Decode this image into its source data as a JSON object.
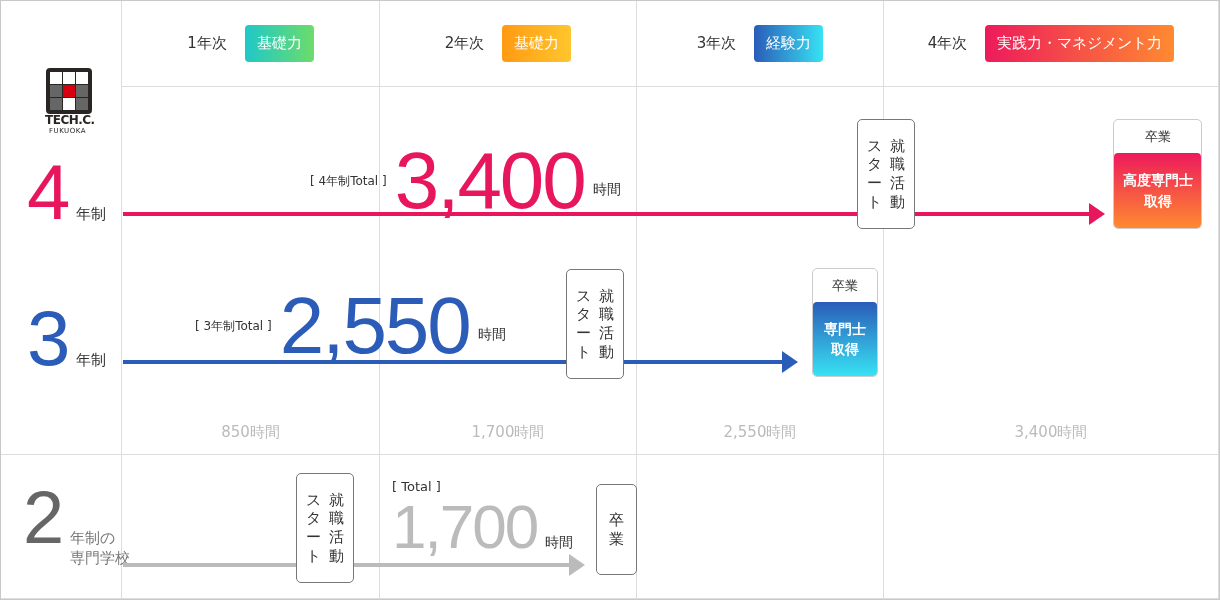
{
  "logo": {
    "name": "TECH.C.",
    "sub": "FUKUOKA"
  },
  "years": [
    {
      "label": "1年次",
      "tag": "基礎力"
    },
    {
      "label": "2年次",
      "tag": "基礎力"
    },
    {
      "label": "3年次",
      "tag": "経験力"
    },
    {
      "label": "4年次",
      "tag": "実践力・マネジメント力"
    }
  ],
  "tracks": [
    {
      "number": "4",
      "unit": [
        "年制"
      ],
      "color": "#e8175d",
      "total_label": "[ 4年制Total ]",
      "total": "3,400",
      "total_unit": "時間",
      "job_start": [
        "スタート",
        "就職活動"
      ],
      "graduation": {
        "kind": "award",
        "label": "卒業",
        "award": [
          "高度専門士",
          "取得"
        ]
      }
    },
    {
      "number": "3",
      "unit": [
        "年制"
      ],
      "color": "#2b5cb8",
      "total_label": "[ 3年制Total ]",
      "total": "2,550",
      "total_unit": "時間",
      "job_start": [
        "スタート",
        "就職活動"
      ],
      "graduation": {
        "kind": "award",
        "label": "卒業",
        "award": [
          "専門士",
          "取得"
        ]
      }
    },
    {
      "number": "2",
      "unit": [
        "年制の",
        "専門学校"
      ],
      "color": "#bbbbbb",
      "total_label": "[ Total ]",
      "total": "1,700",
      "total_unit": "時間",
      "job_start": [
        "スタート",
        "就職活動"
      ],
      "graduation": {
        "kind": "plain",
        "label": "卒業"
      }
    }
  ],
  "milestones": [
    "850時間",
    "1,700時間",
    "2,550時間",
    "3,400時間"
  ]
}
